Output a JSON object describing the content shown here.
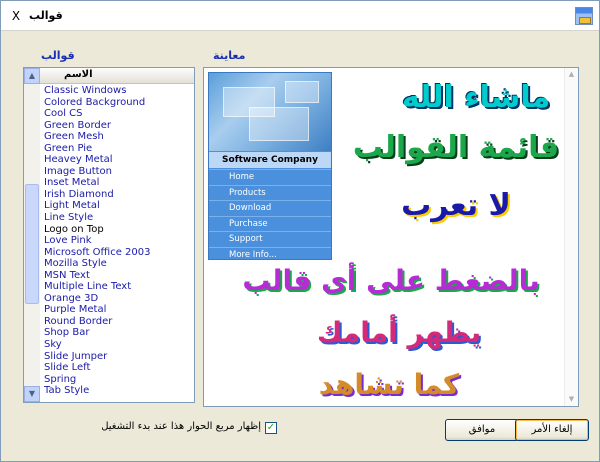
{
  "window": {
    "title": "قوالب",
    "close_glyph": "X"
  },
  "labels": {
    "templates": "قوالب",
    "preview": "معاينة"
  },
  "list": {
    "header": "الاسم",
    "items": [
      "Classic Windows",
      "Colored Background",
      "Cool CS",
      "Green Border",
      "Green Mesh",
      "Green Pie",
      "Heavey Metal",
      "Image Button",
      "Inset Metal",
      "Irish Diamond",
      "Light Metal",
      "Line Style",
      "Logo on Top",
      "Love Pink",
      "Microsoft Office 2003",
      "Mozilla Style",
      "MSN Text",
      "Multiple Line Text",
      "Orange 3D",
      "Purple Metal",
      "Round Border",
      "Shop Bar",
      "Sky",
      "Slide Jumper",
      "Slide Left",
      "Spring",
      "Tab Style"
    ],
    "selected_index": 12
  },
  "preview": {
    "menu_header": "Software Company",
    "menu_items": [
      "Home",
      "Products",
      "Download",
      "Purchase",
      "Support",
      "More Info..."
    ],
    "overlay_lines": [
      "ماشاء الله",
      "قائمة القوالب",
      "لا تعرب",
      "بالضغط على أى قالب",
      "يظهر أمامك",
      "كما تشاهد"
    ]
  },
  "footer": {
    "checkbox_label": "إظهار مربع الحوار هذا عند بدء التشغيل",
    "checkbox_checked": true,
    "checkbox_glyph": "✓",
    "ok_label": "موافق",
    "cancel_label": "إلغاء الأمر"
  },
  "icons": {
    "close": "close-icon",
    "app": "app-window-icon",
    "scroll_up": "scroll-up-icon",
    "scroll_down": "scroll-down-icon"
  },
  "colors": {
    "label_blue": "#1b2fb5",
    "list_text": "#1a1aa8",
    "menu_blue": "#4a90dd"
  }
}
